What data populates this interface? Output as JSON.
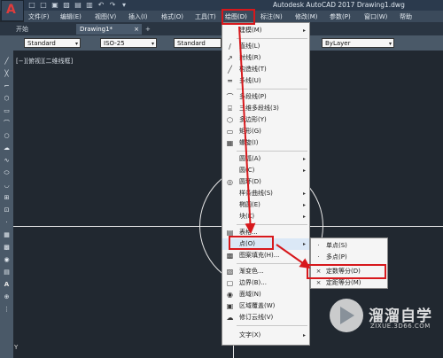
{
  "title_bar": {
    "window_title": "Autodesk AutoCAD 2017    Drawing1.dwg",
    "app_letter": "A",
    "quick_access": [
      "□",
      "□",
      "▣",
      "▨",
      "▤",
      "▥",
      "↶",
      "↷",
      "▾"
    ]
  },
  "menubar": {
    "items": [
      "文件(F)",
      "编辑(E)",
      "视图(V)",
      "插入(I)",
      "格式(O)",
      "工具(T)",
      "绘图(D)",
      "标注(N)",
      "修改(M)",
      "参数(P)",
      "窗口(W)",
      "帮助"
    ]
  },
  "tabs": {
    "items": [
      "开始",
      "Drawing1*"
    ],
    "close": "×",
    "add": "+"
  },
  "toolbar": {
    "text_style": "Standard",
    "dim_style": "ISO-25",
    "table_style": "Standard",
    "layer": "ByLayer"
  },
  "viewport": {
    "label": "[−][俯视][二维线框]",
    "ucs": "Y"
  },
  "draw_menu": {
    "items": [
      {
        "label": "建模(M)",
        "icon": " ",
        "submenu": true
      },
      {
        "label": "直线(L)",
        "icon": "∕",
        "submenu": false
      },
      {
        "label": "射线(R)",
        "icon": "↗",
        "submenu": false
      },
      {
        "label": "构造线(T)",
        "icon": "╱",
        "submenu": false
      },
      {
        "label": "多线(U)",
        "icon": "═",
        "submenu": false
      },
      {
        "label": "多段线(P)",
        "icon": "⌒",
        "submenu": false
      },
      {
        "label": "三维多段线(3)",
        "icon": "⌸",
        "submenu": false
      },
      {
        "label": "多边形(Y)",
        "icon": "⬡",
        "submenu": false
      },
      {
        "label": "矩形(G)",
        "icon": "▭",
        "submenu": false
      },
      {
        "label": "螺旋(I)",
        "icon": "▦",
        "submenu": false
      },
      {
        "label": "圆弧(A)",
        "icon": " ",
        "submenu": true
      },
      {
        "label": "圆(C)",
        "icon": " ",
        "submenu": true
      },
      {
        "label": "圆环(D)",
        "icon": "◎",
        "submenu": false
      },
      {
        "label": "样条曲线(S)",
        "icon": " ",
        "submenu": true
      },
      {
        "label": "椭圆(E)",
        "icon": " ",
        "submenu": true
      },
      {
        "label": "块(K)",
        "icon": " ",
        "submenu": true
      },
      {
        "label": "表格...",
        "icon": "▤",
        "submenu": false
      },
      {
        "label": "点(O)",
        "icon": " ",
        "submenu": true
      },
      {
        "label": "图案填充(H)...",
        "icon": "▩",
        "submenu": false
      },
      {
        "label": "渐变色...",
        "icon": "▧",
        "submenu": false
      },
      {
        "label": "边界(B)...",
        "icon": "▢",
        "submenu": false
      },
      {
        "label": "面域(N)",
        "icon": "◉",
        "submenu": false
      },
      {
        "label": "区域覆盖(W)",
        "icon": "▣",
        "submenu": false
      },
      {
        "label": "修订云线(V)",
        "icon": "☁",
        "submenu": false
      },
      {
        "label": "文字(X)",
        "icon": " ",
        "submenu": true
      }
    ],
    "submenu_arrow": "▸"
  },
  "point_submenu": {
    "items": [
      {
        "label": "单点(S)",
        "icon": "·"
      },
      {
        "label": "多点(P)",
        "icon": "·"
      },
      {
        "label": "定数等分(D)",
        "icon": "⨯"
      },
      {
        "label": "定距等分(M)",
        "icon": "⨯"
      }
    ]
  },
  "watermark": {
    "brand": "溜溜自学",
    "url": "ZIXUE.3D66.COM"
  },
  "colors": {
    "highlight_box": "#d7181c",
    "menu_bg": "#f5f5f5",
    "canvas_bg": "#212830"
  }
}
